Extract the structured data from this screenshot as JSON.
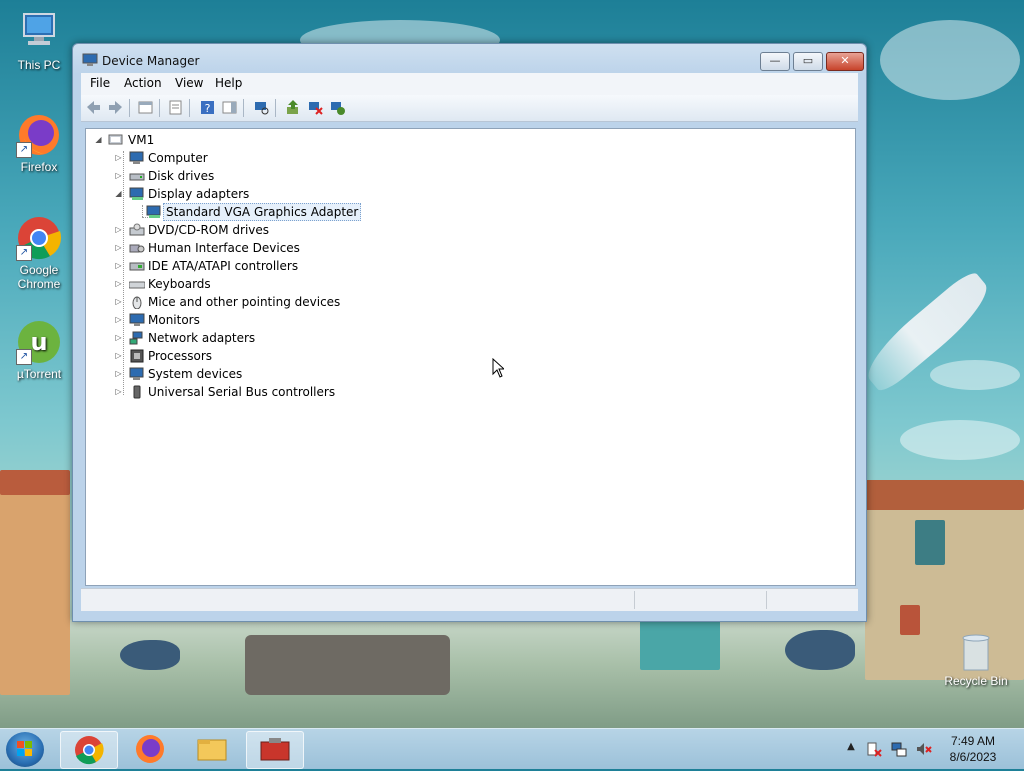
{
  "desktop": {
    "icons": [
      {
        "label": "This PC",
        "icon": "computer-icon"
      },
      {
        "label": "Firefox",
        "icon": "firefox-icon"
      },
      {
        "label": "Google Chrome",
        "icon": "chrome-icon"
      },
      {
        "label": "µTorrent",
        "icon": "utorrent-icon"
      },
      {
        "label": "Recycle Bin",
        "icon": "recycle-bin-icon"
      }
    ]
  },
  "window": {
    "title": "Device Manager",
    "controls": {
      "minimize": "—",
      "maximize": "▭",
      "close": "✕"
    },
    "menu": [
      "File",
      "Action",
      "View",
      "Help"
    ],
    "toolbar": [
      "back-icon",
      "forward-icon",
      "show-hide-console-tree-icon",
      "properties-icon",
      "help-icon",
      "show-action-pane-icon",
      "scan-hardware-icon",
      "update-driver-icon",
      "uninstall-device-icon",
      "add-legacy-hardware-icon"
    ]
  },
  "tree": {
    "root": "VM1",
    "items": [
      {
        "label": "Computer",
        "expanded": false,
        "icon": "computer-device-icon"
      },
      {
        "label": "Disk drives",
        "expanded": false,
        "icon": "disk-drive-icon"
      },
      {
        "label": "Display adapters",
        "expanded": true,
        "icon": "display-adapter-icon",
        "children": [
          {
            "label": "Standard VGA Graphics Adapter",
            "selected": true,
            "icon": "display-adapter-icon"
          }
        ]
      },
      {
        "label": "DVD/CD-ROM drives",
        "expanded": false,
        "icon": "dvd-drive-icon"
      },
      {
        "label": "Human Interface Devices",
        "expanded": false,
        "icon": "hid-icon"
      },
      {
        "label": "IDE ATA/ATAPI controllers",
        "expanded": false,
        "icon": "ide-controller-icon"
      },
      {
        "label": "Keyboards",
        "expanded": false,
        "icon": "keyboard-icon"
      },
      {
        "label": "Mice and other pointing devices",
        "expanded": false,
        "icon": "mouse-icon"
      },
      {
        "label": "Monitors",
        "expanded": false,
        "icon": "monitor-icon"
      },
      {
        "label": "Network adapters",
        "expanded": false,
        "icon": "network-adapter-icon"
      },
      {
        "label": "Processors",
        "expanded": false,
        "icon": "processor-icon"
      },
      {
        "label": "System devices",
        "expanded": false,
        "icon": "system-device-icon"
      },
      {
        "label": "Universal Serial Bus controllers",
        "expanded": false,
        "icon": "usb-icon"
      }
    ]
  },
  "taskbar": {
    "pinned": [
      "chrome-icon",
      "firefox-icon",
      "file-explorer-icon",
      "device-manager-icon"
    ],
    "tray": [
      "show-hidden-icons-icon",
      "action-center-icon",
      "network-icon",
      "volume-muted-icon"
    ],
    "time": "7:49 AM",
    "date": "8/6/2023"
  }
}
